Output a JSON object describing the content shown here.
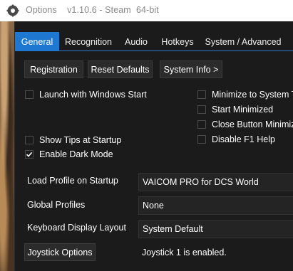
{
  "titlebar": {
    "title": "Options    v1.10.6 - Steam  64-bit",
    "icon": "app-gear-icon"
  },
  "tabs": [
    {
      "label": "General",
      "active": true
    },
    {
      "label": "Recognition",
      "active": false
    },
    {
      "label": "Audio",
      "active": false
    },
    {
      "label": "Hotkeys",
      "active": false
    },
    {
      "label": "System / Advanced",
      "active": false
    }
  ],
  "buttons": {
    "registration": "Registration",
    "reset_defaults": "Reset Defaults",
    "system_info": "System Info >",
    "joystick_options": "Joystick Options"
  },
  "checkboxes": {
    "launch_windows": {
      "label": "Launch with Windows Start",
      "checked": false
    },
    "minimize_tray": {
      "label": "Minimize to System Tr",
      "checked": false
    },
    "start_minimized": {
      "label": "Start Minimized",
      "checked": false
    },
    "close_minimize": {
      "label": "Close Button Minimize",
      "checked": false
    },
    "show_tips": {
      "label": "Show Tips at Startup",
      "checked": false
    },
    "disable_f1": {
      "label": "Disable F1 Help",
      "checked": false
    },
    "dark_mode": {
      "label": "Enable Dark Mode",
      "checked": true
    }
  },
  "fields": {
    "load_profile": {
      "label": "Load Profile on Startup",
      "value": "VAICOM PRO for DCS World"
    },
    "global_profiles": {
      "label": "Global Profiles",
      "value": "None"
    },
    "keyboard_layout": {
      "label": "Keyboard Display Layout",
      "value": "System Default"
    }
  },
  "status": {
    "joystick": "Joystick 1 is enabled."
  },
  "colors": {
    "accent": "#1e78d2",
    "background": "#1b1b1b",
    "field": "#242424"
  }
}
